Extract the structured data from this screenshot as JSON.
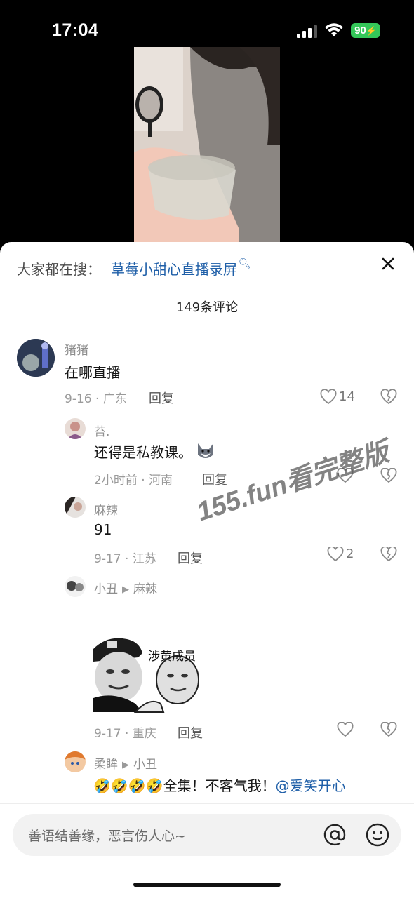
{
  "status_bar": {
    "time": "17:04",
    "battery": "90",
    "battery_color": "#34c759"
  },
  "search": {
    "prefix": "大家都在搜：",
    "query": "草莓小甜心直播录屏",
    "icon": "search-icon"
  },
  "header": {
    "comment_count": "149条评论",
    "close_icon": "close-icon"
  },
  "watermark": "155.fun看完整版",
  "comments": [
    {
      "username": "猪猪",
      "text": "在哪直播",
      "meta": "9-16 · 广东",
      "reply": "回复",
      "likes": "14"
    },
    {
      "username": "苔.",
      "text": "还得是私教课。",
      "meta": "2小时前 · 河南",
      "reply": "回复",
      "likes": ""
    },
    {
      "username": "麻辣",
      "text": "91",
      "meta": "9-17 · 江苏",
      "reply": "回复",
      "likes": "2"
    },
    {
      "username": "小丑",
      "reply_to": "麻辣",
      "meme_text": "涉黄成员",
      "meta": "9-17 · 重庆",
      "reply": "回复",
      "likes": ""
    },
    {
      "username": "柔眸",
      "reply_to": "小丑",
      "emojis": "🤣🤣🤣🤣",
      "text": "全集！不客气我！",
      "mention": "@爱笑开心"
    }
  ],
  "input": {
    "placeholder": "善语结善缘，恶言伤人心~"
  },
  "colors": {
    "link": "#1f5fa8",
    "sheet_bg": "#ffffff",
    "input_bg": "#f2f2f2"
  }
}
